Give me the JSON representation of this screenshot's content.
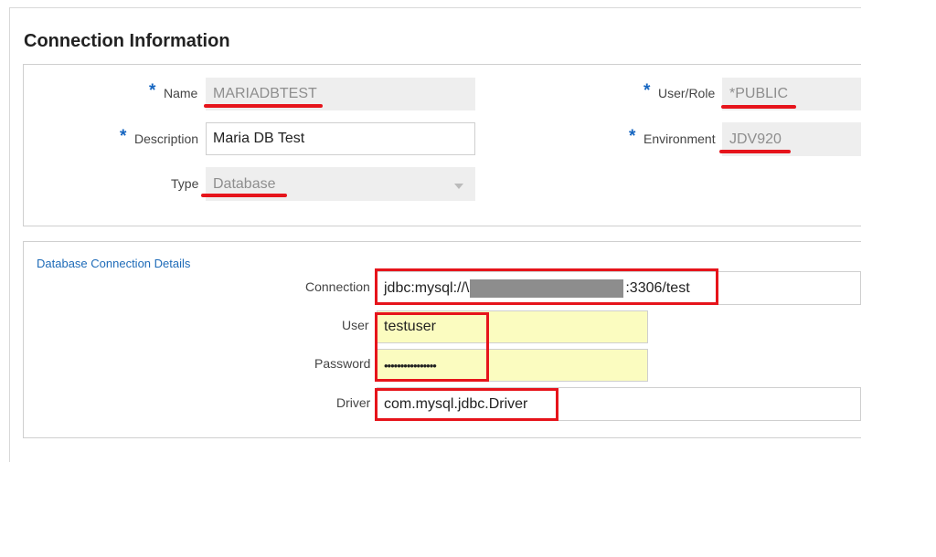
{
  "page": {
    "title": "Connection Information"
  },
  "connection_info": {
    "name": {
      "label": "Name",
      "value": "MARIADBTEST"
    },
    "description": {
      "label": "Description",
      "value": "Maria DB Test"
    },
    "type": {
      "label": "Type",
      "value": "Database"
    },
    "user_role": {
      "label": "User/Role",
      "value": "*PUBLIC"
    },
    "environment": {
      "label": "Environment",
      "value": "JDV920"
    },
    "required_marker": "*"
  },
  "db_details": {
    "section_title": "Database Connection Details",
    "connection": {
      "label": "Connection",
      "value_prefix": "jdbc:mysql://\\",
      "value_suffix": ":3306/test"
    },
    "user": {
      "label": "User",
      "value": "testuser"
    },
    "password": {
      "label": "Password",
      "value": "••••••••••••••••"
    },
    "driver": {
      "label": "Driver",
      "value": "com.mysql.jdbc.Driver"
    }
  },
  "colors": {
    "accent_blue": "#1565c0",
    "annotation_red": "#e6141b",
    "highlight_yellow": "#fbfcc0",
    "readonly_gray": "#eeeeee"
  }
}
